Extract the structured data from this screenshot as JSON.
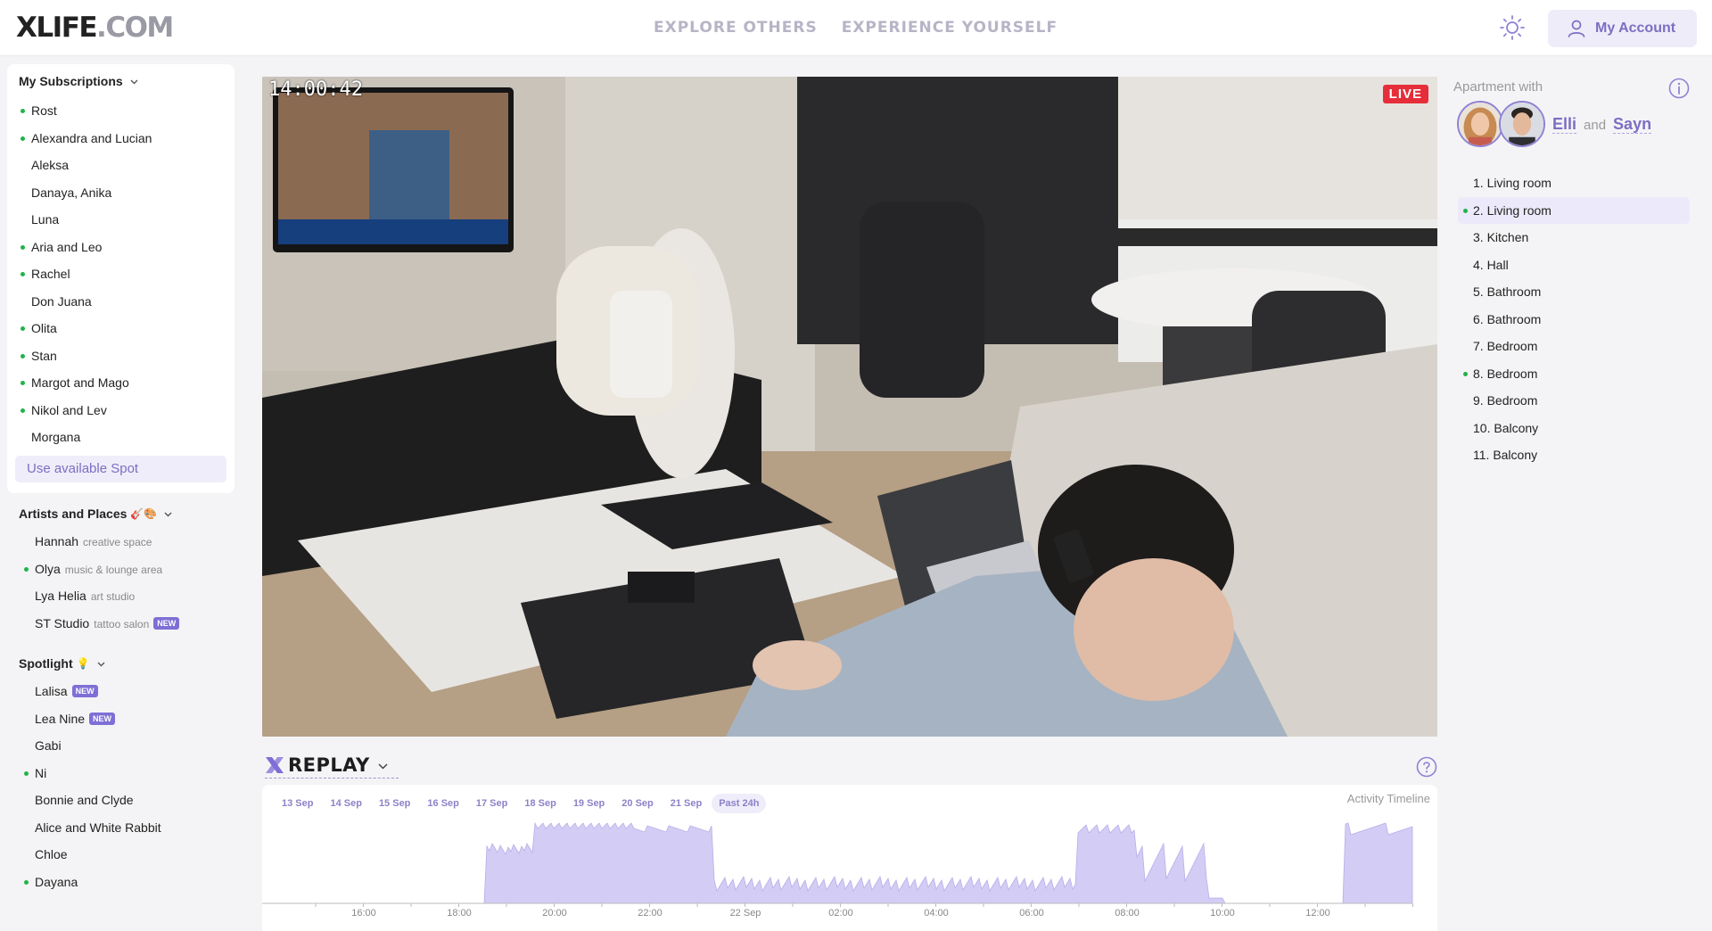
{
  "header": {
    "logo_bold": "XLIFE",
    "logo_light": ".COM",
    "nav": [
      "EXPLORE OTHERS",
      "EXPERIENCE YOURSELF"
    ],
    "account_label": "My Account"
  },
  "subscriptions": {
    "title": "My Subscriptions",
    "items": [
      {
        "label": "Rost",
        "online": true
      },
      {
        "label": "Alexandra and Lucian",
        "online": true
      },
      {
        "label": "Aleksa",
        "online": false
      },
      {
        "label": "Danaya, Anika",
        "online": false
      },
      {
        "label": "Luna",
        "online": false
      },
      {
        "label": "Aria and Leo",
        "online": true
      },
      {
        "label": "Rachel",
        "online": true
      },
      {
        "label": "Don Juana",
        "online": false
      },
      {
        "label": "Olita",
        "online": true
      },
      {
        "label": "Stan",
        "online": true
      },
      {
        "label": "Margot and Mago",
        "online": true
      },
      {
        "label": "Nikol and Lev",
        "online": true
      },
      {
        "label": "Morgana",
        "online": false
      }
    ],
    "spot_button": "Use available Spot"
  },
  "artists": {
    "title": "Artists and Places",
    "emoji": "🎸🎨",
    "items": [
      {
        "label": "Hannah",
        "sub": "creative space",
        "online": false,
        "badge": ""
      },
      {
        "label": "Olya",
        "sub": "music & lounge area",
        "online": true,
        "badge": ""
      },
      {
        "label": "Lya Helia",
        "sub": "art studio",
        "online": false,
        "badge": ""
      },
      {
        "label": "ST Studio",
        "sub": "tattoo salon",
        "online": false,
        "badge": "NEW"
      }
    ]
  },
  "spotlight": {
    "title": "Spotlight",
    "emoji": "💡",
    "items": [
      {
        "label": "Lalisa",
        "online": false,
        "badge": "NEW"
      },
      {
        "label": "Lea Nine",
        "online": false,
        "badge": "NEW"
      },
      {
        "label": "Gabi",
        "online": false,
        "badge": ""
      },
      {
        "label": "Ni",
        "online": true,
        "badge": ""
      },
      {
        "label": "Bonnie and Clyde",
        "online": false,
        "badge": ""
      },
      {
        "label": "Alice and White Rabbit",
        "online": false,
        "badge": ""
      },
      {
        "label": "Chloe",
        "online": false,
        "badge": ""
      },
      {
        "label": "Dayana",
        "online": true,
        "badge": ""
      }
    ]
  },
  "video": {
    "timecode": "14:00:42",
    "live_label": "LIVE"
  },
  "replay": {
    "title": "REPLAY",
    "timeline_title": "Activity Timeline",
    "dates": [
      "13 Sep",
      "14 Sep",
      "15 Sep",
      "16 Sep",
      "17 Sep",
      "18 Sep",
      "19 Sep",
      "20 Sep",
      "21 Sep",
      "Past 24h"
    ],
    "active_date": "Past 24h",
    "hour_labels": [
      "16:00",
      "18:00",
      "20:00",
      "22:00",
      "22 Sep",
      "02:00",
      "04:00",
      "06:00",
      "08:00",
      "10:00",
      "12:00"
    ],
    "activity_color": "#d3ccf4"
  },
  "apartment": {
    "label": "Apartment with",
    "name1": "Elli",
    "and": "and",
    "name2": "Sayn",
    "rooms": [
      {
        "label": "1. Living room",
        "online": false,
        "active": false
      },
      {
        "label": "2. Living room",
        "online": true,
        "active": true
      },
      {
        "label": "3. Kitchen",
        "online": false,
        "active": false
      },
      {
        "label": "4. Hall",
        "online": false,
        "active": false
      },
      {
        "label": "5. Bathroom",
        "online": false,
        "active": false
      },
      {
        "label": "6. Bathroom",
        "online": false,
        "active": false
      },
      {
        "label": "7. Bedroom",
        "online": false,
        "active": false
      },
      {
        "label": "8. Bedroom",
        "online": true,
        "active": false
      },
      {
        "label": "9. Bedroom",
        "online": false,
        "active": false
      },
      {
        "label": "10. Balcony",
        "online": false,
        "active": false
      },
      {
        "label": "11. Balcony",
        "online": false,
        "active": false
      }
    ]
  },
  "colors": {
    "accent": "#7d6ec2",
    "online": "#20b34a",
    "live": "#e52e3a"
  }
}
